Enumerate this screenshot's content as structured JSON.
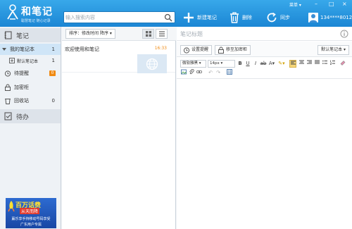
{
  "app": {
    "name": "和笔记",
    "slogan": "聪慧笔记 随心记录",
    "menu_label": "菜单",
    "user_phone": "134****8012"
  },
  "search": {
    "placeholder": "输入搜索内容"
  },
  "toolbar": {
    "new_label": "新建笔记",
    "delete_label": "删除",
    "sync_label": "同步"
  },
  "sidebar": {
    "notes_header": "笔记",
    "todo_header": "待办",
    "items": [
      {
        "label": "我的笔记本",
        "count": "1",
        "icon": "triangle-down"
      },
      {
        "label": "默认笔记本",
        "count": "1",
        "icon": "plus-box"
      },
      {
        "label": "待提醒",
        "count": "0",
        "icon": "alarm-icon"
      },
      {
        "label": "加密柜",
        "count": "",
        "icon": "lock-icon"
      },
      {
        "label": "回收站",
        "count": "0",
        "icon": "trash-icon"
      }
    ]
  },
  "ad": {
    "title": "百万话费",
    "subtitle": "从天而降",
    "line1": "赢乐享手持移动号码享受",
    "line2": "广东用户专属"
  },
  "notelist": {
    "sort_label": "排序：修改时间",
    "sort_suffix": "降序",
    "notes": [
      {
        "title": "欢迎使用和笔记",
        "time": "16:33"
      }
    ]
  },
  "editor": {
    "title_placeholder": "笔记标题",
    "reminder_label": "设置提醒",
    "encrypt_label": "移至加密柜",
    "notebook_select": "默认笔记本",
    "font_family": "微软雅黑",
    "font_size": "14px"
  },
  "colors": {
    "titlebar": "#1e90db",
    "accent": "#f08a12",
    "selected": "#cfe5f7"
  }
}
